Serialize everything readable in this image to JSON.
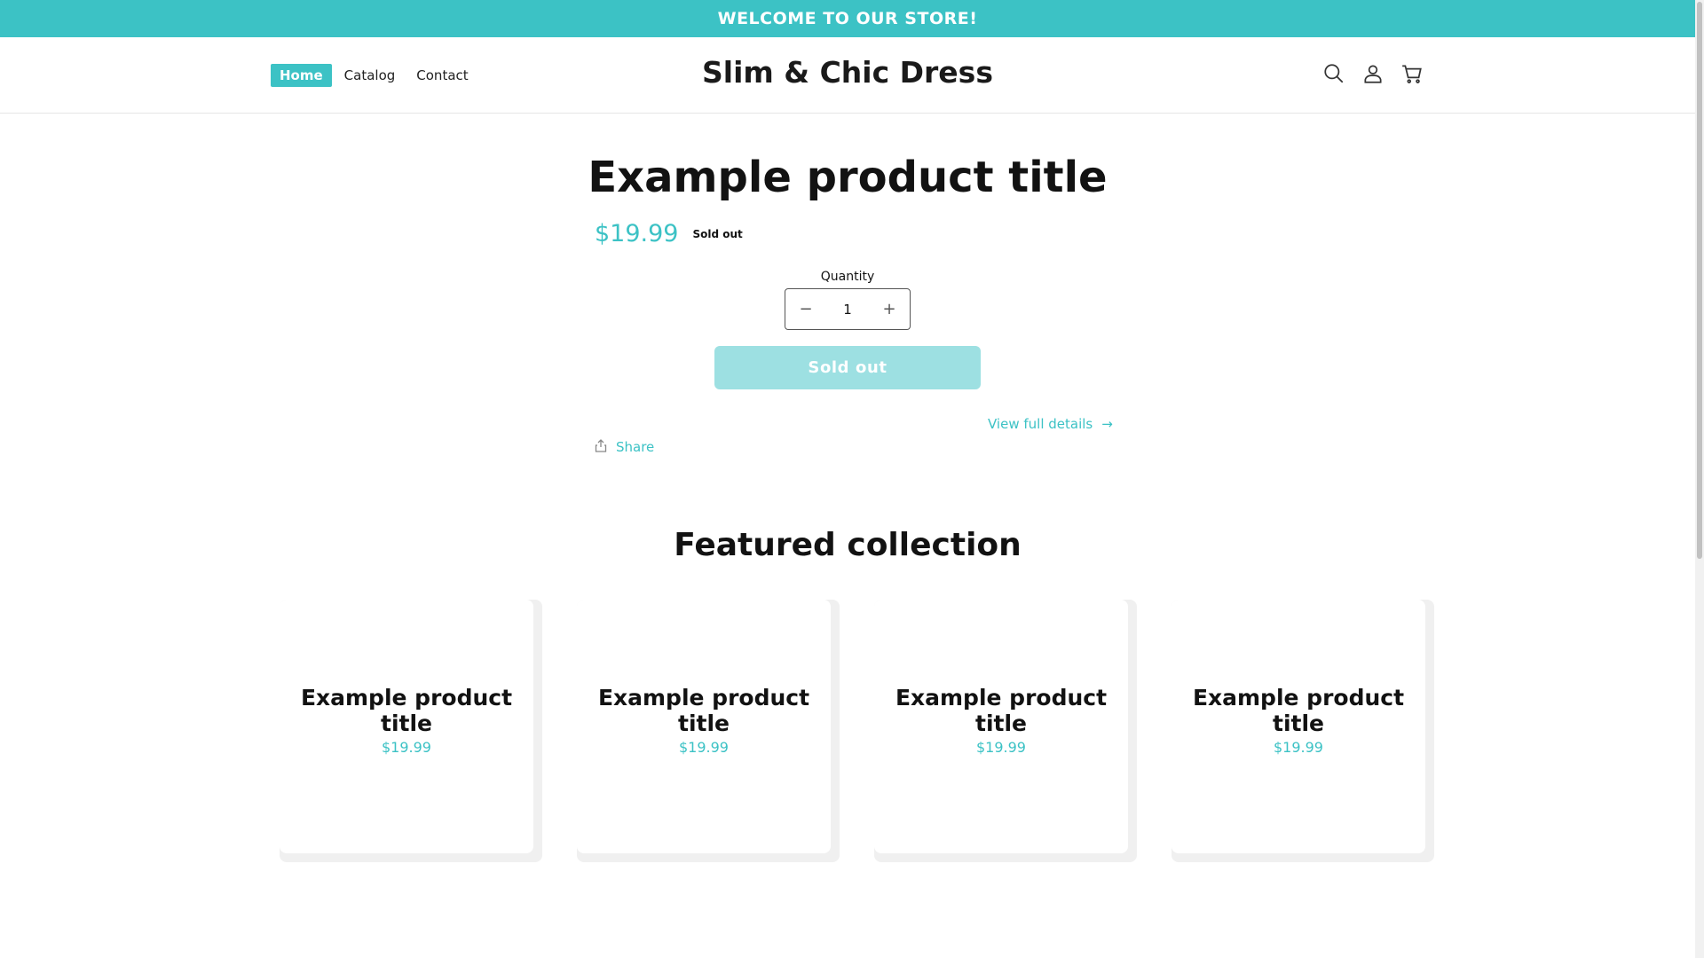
{
  "announcement": "WELCOME TO OUR STORE!",
  "nav": {
    "items": [
      {
        "label": "Home",
        "active": true
      },
      {
        "label": "Catalog",
        "active": false
      },
      {
        "label": "Contact",
        "active": false
      }
    ]
  },
  "store_name": "Slim & Chic Dress",
  "header_icons": [
    "search-icon",
    "account-icon",
    "cart-icon"
  ],
  "product": {
    "title": "Example product title",
    "price": "$19.99",
    "badge": "Sold out",
    "quantity_label": "Quantity",
    "quantity_value": "1",
    "button_label": "Sold out",
    "view_details": "View full details",
    "share": "Share"
  },
  "featured": {
    "title": "Featured collection",
    "cards": [
      {
        "title": "Example product title",
        "price": "$19.99"
      },
      {
        "title": "Example product title",
        "price": "$19.99"
      },
      {
        "title": "Example product title",
        "price": "$19.99"
      },
      {
        "title": "Example product title",
        "price": "$19.99"
      }
    ]
  },
  "colors": {
    "accent": "#3cc2c5",
    "button_disabled": "#9de0e2",
    "text": "#121212"
  }
}
